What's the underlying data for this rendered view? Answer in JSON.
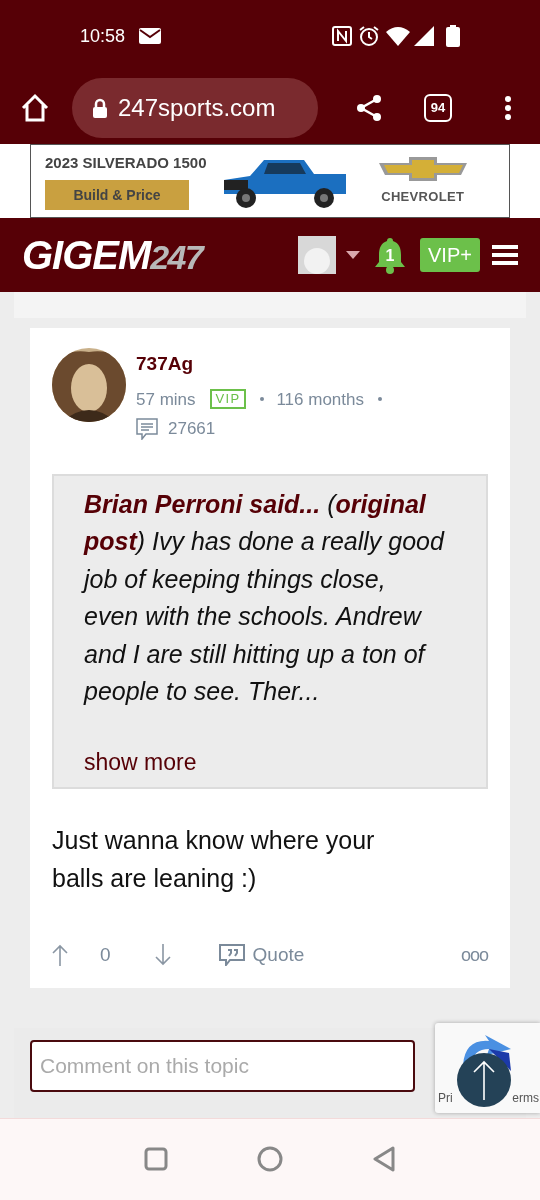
{
  "status_bar": {
    "time": "10:58"
  },
  "browser": {
    "url": "247sports.com",
    "tab_count": "94"
  },
  "ad": {
    "headline": "2023 SILVERADO 1500",
    "cta": "Build & Price",
    "brand": "CHEVROLET"
  },
  "site_header": {
    "logo_main": "GIGEM",
    "logo_suffix": "247",
    "notification_count": "1",
    "vip_button": "VIP+"
  },
  "post": {
    "author": "737Ag",
    "age": "57 mins",
    "badge": "VIP",
    "tenure": "116 months",
    "post_count": "27661",
    "quote": {
      "text": "**Brian Perroni said...** (**original post**) Ivy has done a really good job of keeping things close, even with the schools. Andrew and I are still hitting up a ton of people to see. Ther...",
      "show_more": "show more"
    },
    "body": "Just wanna know where your balls are leaning :)",
    "votes": "0",
    "quote_button": "Quote",
    "more": "ooo"
  },
  "comment": {
    "placeholder": "Comment on this topic"
  },
  "recaptcha": {
    "left_text": "Pri",
    "right_text": "erms"
  }
}
